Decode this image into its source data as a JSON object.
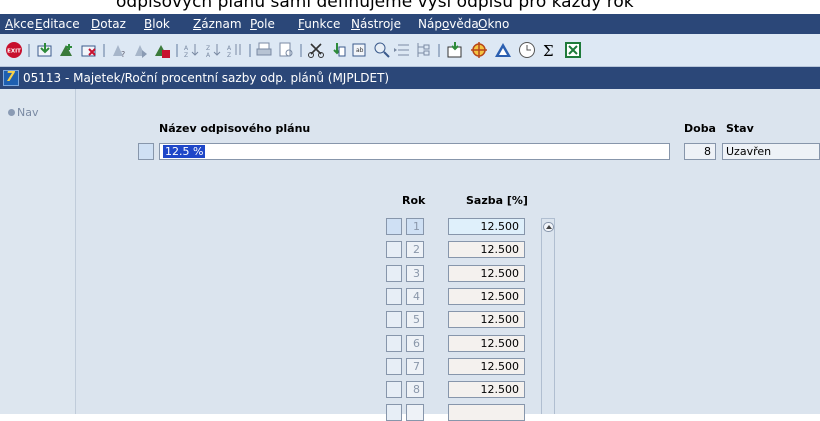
{
  "caption": "odpisových plánů sami definujeme výši odpisu pro každý rok",
  "menu": [
    "Akce",
    "Editace",
    "Dotaz",
    "Blok",
    "Záznam",
    "Pole",
    "Funkce",
    "Nástroje",
    "Nápověda",
    "Okno"
  ],
  "menu_underline": [
    "A",
    "E",
    "D",
    "B",
    "Z",
    "P",
    "F",
    "N",
    "o",
    "O"
  ],
  "window_title": "05113 - Majetek/Roční procentní sazby odp. plánů (MJPLDET)",
  "nav_label": "Nav",
  "header": {
    "name_label": "Název odpisového plánu",
    "name_value": "12.5 %",
    "doba_label": "Doba",
    "doba_value": "8",
    "stav_label": "Stav",
    "stav_value": "Uzavřen"
  },
  "table": {
    "col_rok": "Rok",
    "col_sazba": "Sazba [%]",
    "rows": [
      {
        "rok": "1",
        "sazba": "12.500"
      },
      {
        "rok": "2",
        "sazba": "12.500"
      },
      {
        "rok": "3",
        "sazba": "12.500"
      },
      {
        "rok": "4",
        "sazba": "12.500"
      },
      {
        "rok": "5",
        "sazba": "12.500"
      },
      {
        "rok": "6",
        "sazba": "12.500"
      },
      {
        "rok": "7",
        "sazba": "12.500"
      },
      {
        "rok": "8",
        "sazba": "12.500"
      },
      {
        "rok": "",
        "sazba": ""
      }
    ]
  },
  "toolbar_icons": [
    "exit-icon",
    "save-icon",
    "new-record-icon",
    "delete-record-icon",
    "query-enter-icon",
    "query-execute-icon",
    "query-cancel-icon",
    "sort-asc-icon",
    "sort-desc-icon",
    "sort-custom-icon",
    "print-icon",
    "print-preview-icon",
    "cut-icon",
    "copy-icon",
    "paste-icon",
    "zoom-icon",
    "list-icon",
    "tree-icon",
    "export-icon",
    "tools-icon",
    "warning-icon",
    "clock-icon",
    "sum-icon",
    "excel-icon"
  ],
  "colors": {
    "menu_bg": "#2b4778",
    "toolbar_bg": "#dde8f4",
    "content_bg": "#dbe4ee",
    "selection": "#1f47c8"
  }
}
